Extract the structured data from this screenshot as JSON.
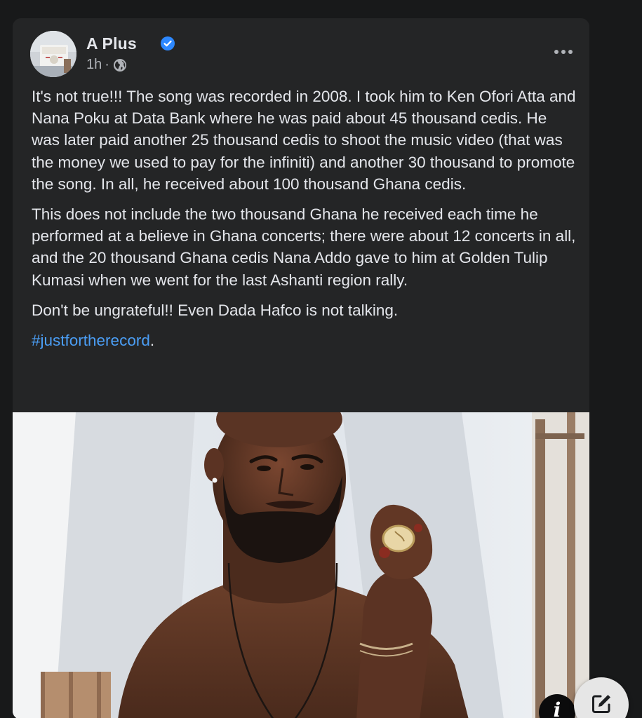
{
  "post": {
    "author": "A Plus",
    "time": "1h",
    "separator": "·",
    "privacy_icon": "globe-icon",
    "verified_icon": "verified-badge-icon",
    "more_icon": "more-options-icon",
    "paragraphs": [
      "It's not true!!! The song was recorded in 2008. I took him to Ken Ofori Atta and Nana Poku at Data Bank where he was paid about 45 thousand cedis. He was later paid another 25 thousand cedis to shoot the music video (that was the money we used to pay for the infiniti) and another 30 thousand to promote the song. In all, he received about 100 thousand Ghana cedis.",
      "This does not include the two thousand Ghana he received each time he performed at a believe in Ghana concerts; there were about 12 concerts in all, and the 20 thousand Ghana cedis Nana Addo gave to him at Golden Tulip Kumasi when we went for the last Ashanti region rally.",
      "Don't be ungrateful!! Even Dada Hafco is not talking."
    ],
    "hashtag": "#justfortherecord",
    "hashtag_suffix": "."
  },
  "floating": {
    "info_glyph": "i",
    "info_icon": "info-icon",
    "compose_icon": "compose-edit-icon"
  },
  "colors": {
    "background": "#18191a",
    "card": "#242526",
    "text_primary": "#e4e6eb",
    "text_secondary": "#b0b3b8",
    "link": "#4b9ef5",
    "verified": "#2d88ff"
  }
}
